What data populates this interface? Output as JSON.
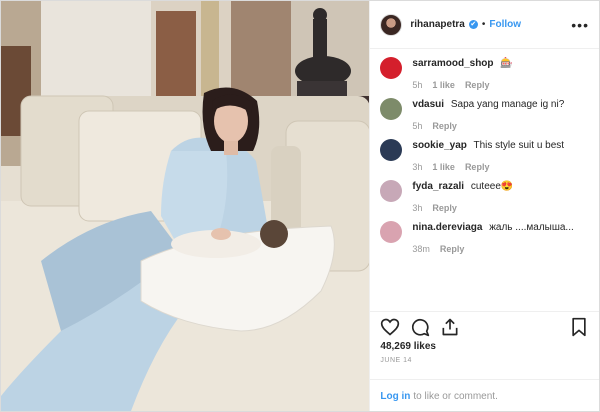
{
  "header": {
    "username": "rihanapetra",
    "verified_glyph": "✔",
    "separator": "•",
    "follow_label": "Follow",
    "more_glyph": "•••"
  },
  "comments": [
    {
      "user": "sarramood_shop",
      "text": "🎰",
      "time": "5h",
      "likes": "1 like",
      "reply": "Reply",
      "avatar_color": "#d41f2c"
    },
    {
      "user": "vdasui",
      "text": "Sapa yang manage ig ni?",
      "time": "5h",
      "likes": "",
      "reply": "Reply",
      "avatar_color": "#7d8b6a"
    },
    {
      "user": "sookie_yap",
      "text": "This style suit u best",
      "time": "3h",
      "likes": "1 like",
      "reply": "Reply",
      "avatar_color": "#2b3a55"
    },
    {
      "user": "fyda_razali",
      "text": "cuteee😍",
      "time": "3h",
      "likes": "",
      "reply": "Reply",
      "avatar_color": "#c7a8b7"
    },
    {
      "user": "nina.dereviaga",
      "text": "жаль ....малыша...",
      "time": "38m",
      "likes": "",
      "reply": "Reply",
      "avatar_color": "#d9a3b0"
    }
  ],
  "actions": {
    "like_icon": "heart-icon",
    "comment_icon": "comment-icon",
    "share_icon": "share-icon",
    "save_icon": "bookmark-icon"
  },
  "likes_count": "48,269 likes",
  "date": "JUNE 14",
  "login": {
    "link": "Log in",
    "text": "to like or comment."
  },
  "colors": {
    "accent": "#3897f0",
    "muted": "#999999",
    "text": "#262626",
    "dress": "#bcd3e4"
  }
}
